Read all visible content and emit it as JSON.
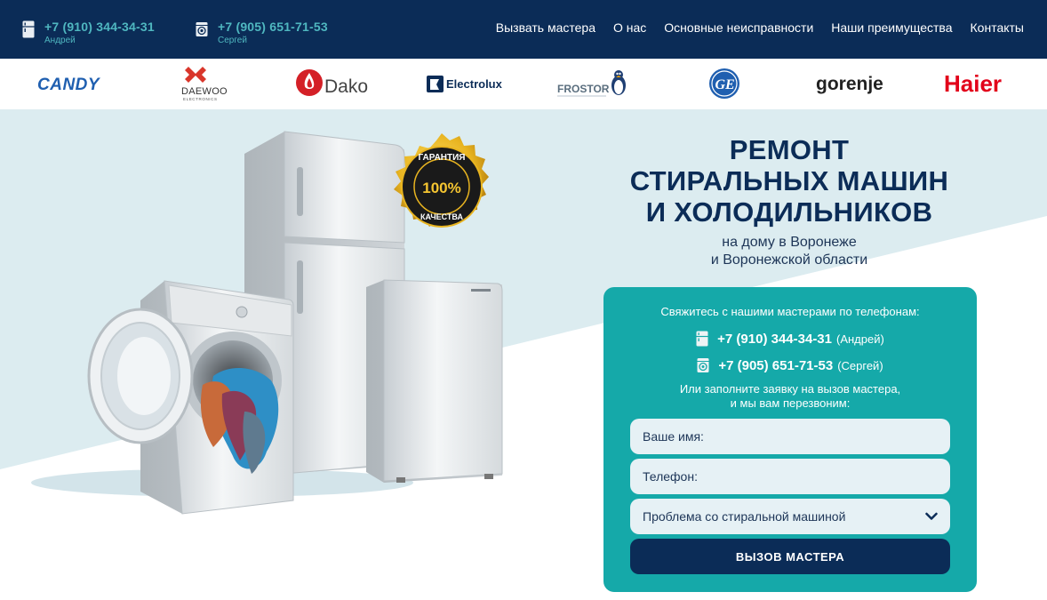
{
  "header": {
    "phones": [
      {
        "number": "+7 (910) 344-34-31",
        "name": "Андрей",
        "icon": "fridge-icon"
      },
      {
        "number": "+7 (905) 651-71-53",
        "name": "Сергей",
        "icon": "washing-machine-icon"
      }
    ],
    "nav": [
      "Вызвать мастера",
      "О нас",
      "Основные неисправности",
      "Наши преимущества",
      "Контакты"
    ]
  },
  "brands": [
    "CANDY",
    "DAEWOO",
    "ELECTRONICS",
    "Dako",
    "Electrolux",
    "FROSTOR",
    "GE",
    "gorenje",
    "Haier"
  ],
  "hero": {
    "title_line1": "РЕМОНТ",
    "title_line2": "СТИРАЛЬНЫХ МАШИН",
    "title_line3": "И ХОЛОДИЛЬНИКОВ",
    "subtitle_line1": "на дому в Воронеже",
    "subtitle_line2": "и Воронежской области",
    "badge_top": "ГАРАНТИЯ",
    "badge_percent": "100%",
    "badge_bottom": "КАЧЕСТВА"
  },
  "form": {
    "lead": "Свяжитесь с нашими мастерами по телефонам:",
    "phones": [
      {
        "number": "+7 (910) 344-34-31",
        "name": "(Андрей)"
      },
      {
        "number": "+7 (905) 651-71-53",
        "name": "(Сергей)"
      }
    ],
    "or_line1": "Или заполните заявку на вызов мастера,",
    "or_line2": "и мы вам перезвоним:",
    "name_placeholder": "Ваше имя:",
    "phone_placeholder": "Телефон:",
    "problem_selected": "Проблема со стиральной машиной",
    "submit_label": "ВЫЗОВ МАСТЕРА"
  },
  "colors": {
    "header_bg": "#0b2c57",
    "accent_teal": "#15a9a9",
    "phone_teal": "#4fb7c0",
    "hero_bg": "#dcecf0",
    "candy_blue": "#1f5fb0",
    "daewoo_red": "#d9362b",
    "dako_red": "#d42027",
    "haier_red": "#e2001a"
  }
}
